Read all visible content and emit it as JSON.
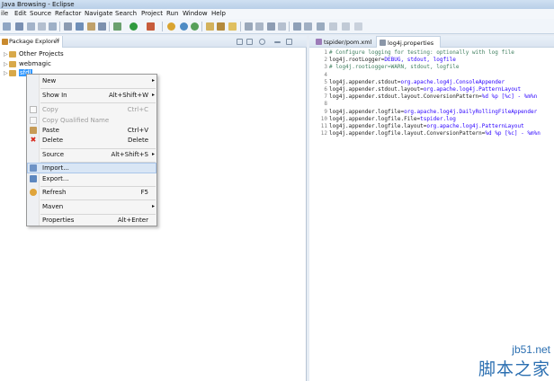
{
  "window": {
    "title": "Java Browsing - Eclipse"
  },
  "menu": [
    "ile",
    "Edit",
    "Source",
    "Refactor",
    "Navigate",
    "Search",
    "Project",
    "Run",
    "Window",
    "Help"
  ],
  "package_explorer": {
    "tab_label": "Package Explorer",
    "close": "✕",
    "items": [
      {
        "label": "Other Projects",
        "twisty": "▷"
      },
      {
        "label": "webmagic",
        "twisty": "▷"
      },
      {
        "label": "sfdl",
        "twisty": "▷"
      }
    ]
  },
  "context_menu": {
    "items": [
      {
        "label": "New",
        "shortcut": "",
        "submenu": true,
        "disabled": false,
        "icon": ""
      },
      {
        "label": "Show In",
        "shortcut": "Alt+Shift+W",
        "submenu": true,
        "disabled": false,
        "icon": ""
      },
      {
        "label": "Copy",
        "shortcut": "Ctrl+C",
        "submenu": false,
        "disabled": true,
        "icon": "copy-icon"
      },
      {
        "label": "Copy Qualified Name",
        "shortcut": "",
        "submenu": false,
        "disabled": true,
        "icon": "copy-qualified-icon"
      },
      {
        "label": "Paste",
        "shortcut": "Ctrl+V",
        "submenu": false,
        "disabled": false,
        "icon": "paste-icon"
      },
      {
        "label": "Delete",
        "shortcut": "Delete",
        "submenu": false,
        "disabled": false,
        "icon": "delete-icon"
      },
      {
        "label": "Source",
        "shortcut": "Alt+Shift+S",
        "submenu": true,
        "disabled": false,
        "icon": ""
      },
      {
        "label": "Import...",
        "shortcut": "",
        "submenu": false,
        "disabled": false,
        "icon": "import-icon"
      },
      {
        "label": "Export...",
        "shortcut": "",
        "submenu": false,
        "disabled": false,
        "icon": "export-icon"
      },
      {
        "label": "Refresh",
        "shortcut": "F5",
        "submenu": false,
        "disabled": false,
        "icon": "refresh-icon"
      },
      {
        "label": "Maven",
        "shortcut": "",
        "submenu": true,
        "disabled": false,
        "icon": ""
      },
      {
        "label": "Properties",
        "shortcut": "Alt+Enter",
        "submenu": false,
        "disabled": false,
        "icon": ""
      }
    ],
    "arrow": "▸",
    "delete_glyph": "✖"
  },
  "editor": {
    "tabs": [
      {
        "label": "tspider/pom.xml",
        "active": false
      },
      {
        "label": "log4j.properties",
        "active": true
      }
    ],
    "lines": [
      {
        "n": "1",
        "parts": [
          {
            "t": "# Configure logging for testing: optionally with log file",
            "c": "cm"
          }
        ]
      },
      {
        "n": "2",
        "parts": [
          {
            "t": "log4j.rootLogger=",
            "c": "ky"
          },
          {
            "t": "DEBUG, stdout, logfile",
            "c": "vl"
          }
        ]
      },
      {
        "n": "3",
        "parts": [
          {
            "t": "# log4j.rootLogger=WARN, stdout, logfile",
            "c": "cm"
          }
        ]
      },
      {
        "n": "4",
        "parts": []
      },
      {
        "n": "5",
        "parts": [
          {
            "t": "log4j.appender.stdout=",
            "c": "ky"
          },
          {
            "t": "org.apache.log4j.ConsoleAppender",
            "c": "vl"
          }
        ]
      },
      {
        "n": "6",
        "parts": [
          {
            "t": "log4j.appender.stdout.layout=",
            "c": "ky"
          },
          {
            "t": "org.apache.log4j.PatternLayout",
            "c": "vl"
          }
        ]
      },
      {
        "n": "7",
        "parts": [
          {
            "t": "log4j.appender.stdout.layout.ConversionPattern=",
            "c": "ky"
          },
          {
            "t": "%d %p [%c] - %m%n",
            "c": "vl"
          }
        ]
      },
      {
        "n": "8",
        "parts": []
      },
      {
        "n": "9",
        "parts": [
          {
            "t": "log4j.appender.logfile=",
            "c": "ky"
          },
          {
            "t": "org.apache.log4j.DailyRollingFileAppender",
            "c": "vl"
          }
        ]
      },
      {
        "n": "10",
        "parts": [
          {
            "t": "log4j.appender.logfile.File=",
            "c": "ky"
          },
          {
            "t": "tspider.log",
            "c": "vl"
          }
        ]
      },
      {
        "n": "11",
        "parts": [
          {
            "t": "log4j.appender.logfile.layout=",
            "c": "ky"
          },
          {
            "t": "org.apache.log4j.PatternLayout",
            "c": "vl"
          }
        ]
      },
      {
        "n": "12",
        "parts": [
          {
            "t": "log4j.appender.logfile.layout.ConversionPattern=",
            "c": "ky"
          },
          {
            "t": "%d %p [%c] - %m%n",
            "c": "vl"
          }
        ]
      }
    ]
  },
  "watermark": {
    "url": "jb51.net",
    "cn": "脚本之家"
  }
}
